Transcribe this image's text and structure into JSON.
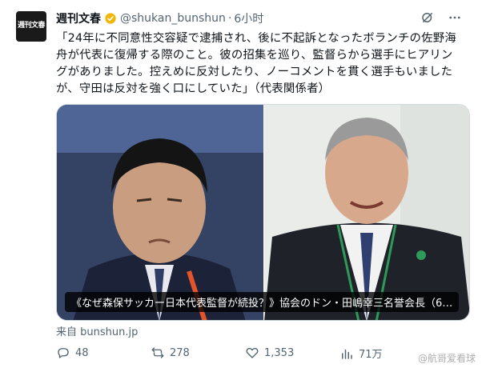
{
  "avatar": {
    "text": "週刊文春"
  },
  "header": {
    "display_name": "週刊文春",
    "handle": "@shukan_bunshun",
    "separator": "·",
    "time": "6小时"
  },
  "tweet": {
    "text": "「24年に不同意性交容疑で逮捕され、後に不起訴となったボランチの佐野海\n舟が代表に復帰する際のこと。彼の招集を巡り、監督らから選手にヒアリン\nグがありました。控えめに反対したり、ノーコメントを貫く選手もいました\nが、守田は反対を強く口にしていた」（代表関係者）"
  },
  "media": {
    "caption": "《なぜ森保サッカー日本代表監督が続投？》協会のドン・田嶋幸三名誉会長（6…"
  },
  "source": {
    "text": "来自 bunshun.jp"
  },
  "actions": {
    "reply": "48",
    "retweet": "278",
    "like": "1,353",
    "views": "71万"
  },
  "watermark": {
    "text": "@航哥爱看球"
  },
  "colors": {
    "verified": "#f2b705",
    "muted": "#536471"
  }
}
